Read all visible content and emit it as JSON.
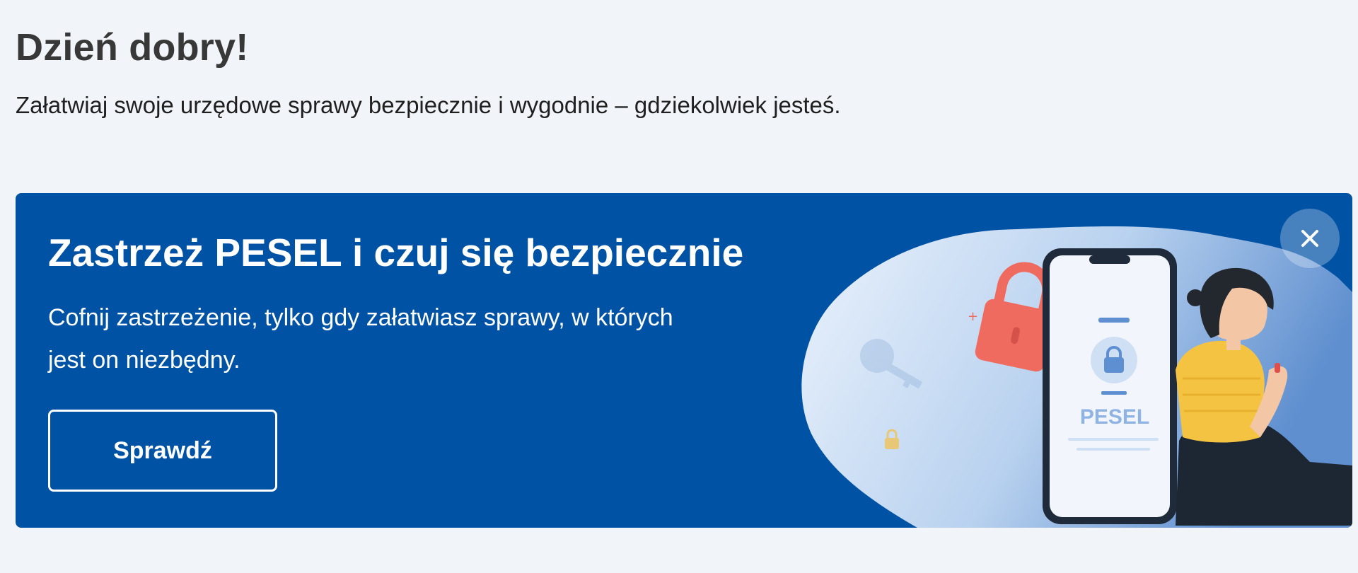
{
  "header": {
    "greeting": "Dzień dobry!",
    "subtitle": "Załatwiaj swoje urzędowe sprawy bezpiecznie i wygodnie – gdziekolwiek jesteś."
  },
  "banner": {
    "title": "Zastrzeż PESEL i czuj się bezpiecznie",
    "text": "Cofnij zastrzeżenie, tylko gdy załatwiasz sprawy, w których jest on niezbędny.",
    "button_label": "Sprawdź",
    "close_icon": "close-icon",
    "phone_label": "PESEL",
    "colors": {
      "background": "#0052a5",
      "page": "#f1f5f9",
      "accent_lock": "#f06b5e",
      "shirt": "#f5c342"
    }
  }
}
